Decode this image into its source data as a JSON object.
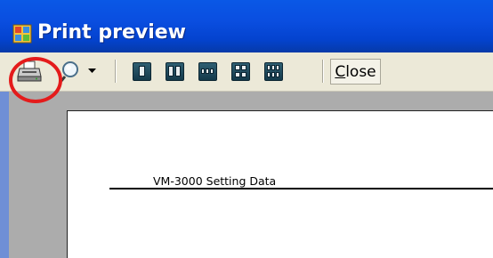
{
  "window": {
    "title": "Print preview"
  },
  "toolbar": {
    "print_icon": "printer-icon",
    "zoom_icon": "magnifier-icon",
    "zoom_dropdown_icon": "chevron-down-icon",
    "page_layout_icons": [
      "one-page-icon",
      "two-pages-icon",
      "three-pages-icon",
      "four-pages-icon",
      "six-pages-icon"
    ],
    "close_label_underlined": "C",
    "close_label_rest": "lose"
  },
  "document": {
    "heading": "VM-3000 Setting Data"
  },
  "annotation": {
    "color": "#e41b1b"
  },
  "colors": {
    "titlebar": "#0a4ee0",
    "toolbar": "#ece9d8",
    "workarea": "#acacac"
  }
}
